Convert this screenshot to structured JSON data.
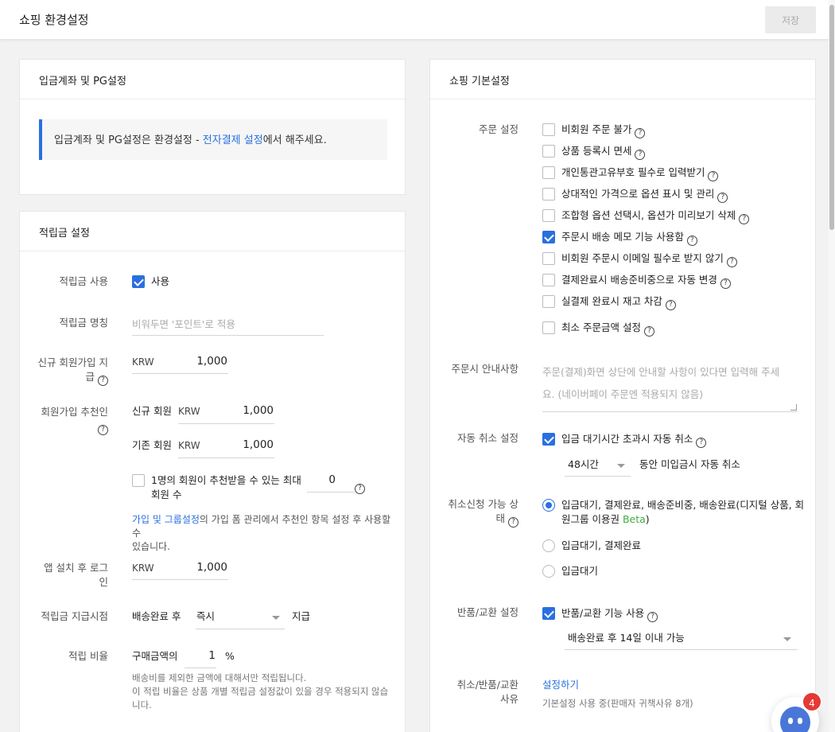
{
  "header": {
    "title": "쇼핑 환경설정",
    "save_label": "저장"
  },
  "payment": {
    "title": "입금계좌 및 PG설정",
    "notice_pre": "입금계좌 및 PG설정은 환경설정 - ",
    "notice_link": "전자결제 설정",
    "notice_post": "에서 해주세요."
  },
  "points": {
    "title": "적립금 설정",
    "use_label": "적립금 사용",
    "use_checkbox_label": "사용",
    "use_checked": true,
    "name_label": "적립금 명칭",
    "name_placeholder": "비워두면 '포인트'로 적용",
    "signup_label_1": "신규 회원가입 지",
    "signup_label_2": "급",
    "signup_currency": "KRW",
    "signup_value": "1,000",
    "referral_label": "회원가입 추천인",
    "new_member_label": "신규 회원",
    "new_member_currency": "KRW",
    "new_member_value": "1,000",
    "existing_member_label": "기존 회원",
    "existing_member_currency": "KRW",
    "existing_member_value": "1,000",
    "max_ref_label_1": "1명의 회원이 추천받을 수 있는 최대",
    "max_ref_label_2": "회원 수",
    "max_ref_value": "0",
    "max_ref_checked": false,
    "ref_note_link": "가입 및 그룹설정",
    "ref_note_1": "의 가입 폼 관리에서 추천인 항목 설정 후 사용할 수",
    "ref_note_2": "있습니다.",
    "app_label_1": "앱 설치 후 로그",
    "app_label_2": "인",
    "app_currency": "KRW",
    "app_value": "1,000",
    "timing_label": "적립금 지급시점",
    "timing_pre": "배송완료 후",
    "timing_value": "즉시",
    "timing_post": "지급",
    "rate_label": "적립 비율",
    "rate_pre": "구매금액의",
    "rate_value": "1",
    "rate_unit": "%",
    "rate_note_1": "배송비를 제외한 금액에 대해서만 적립됩니다.",
    "rate_note_2": "이 적립 비율은 상품 개별 적립금 설정값이 있을 경우 적용되지 않습",
    "rate_note_3": "니다."
  },
  "shopping": {
    "title": "쇼핑 기본설정",
    "order_label": "주문 설정",
    "order_options": [
      {
        "label": "비회원 주문 불가",
        "checked": false
      },
      {
        "label": "상품 등록시 면세",
        "checked": false
      },
      {
        "label": "개인통관고유부호 필수로 입력받기",
        "checked": false
      },
      {
        "label": "상대적인 가격으로 옵션 표시 및 관리",
        "checked": false
      },
      {
        "label": "조합형 옵션 선택시, 옵션가 미리보기 삭제",
        "checked": false
      },
      {
        "label": "주문시 배송 메모 기능 사용함",
        "checked": true
      },
      {
        "label": "비회원 주문시 이메일 필수로 받지 않기",
        "checked": false
      },
      {
        "label": "결제완료시 배송준비중으로 자동 변경",
        "checked": false
      },
      {
        "label": "실결제 완료시 재고 차감",
        "checked": false
      },
      {
        "label": "최소 주문금액 설정",
        "checked": false
      }
    ],
    "notice_label": "주문시 안내사항",
    "notice_placeholder_1": "주문(결제)화면 상단에 안내할 사항이 있다면 입력해 주세",
    "notice_placeholder_2": "요. (네이버페이 주문엔 적용되지 않음)",
    "auto_cancel_label": "자동 취소 설정",
    "auto_cancel_checkbox": "입금 대기시간 초과시 자동 취소",
    "auto_cancel_checked": true,
    "auto_cancel_time": "48시간",
    "auto_cancel_post": "동안 미입금시 자동 취소",
    "cancel_state_label_1": "취소신청 가능 상",
    "cancel_state_label_2": "태",
    "cancel_state_options": [
      {
        "line1": "입금대기, 결제완료, 배송준비중, 배송완료(디지털 상품, 회",
        "line2_pre": "원그룹 이용권 ",
        "beta": "Beta",
        "line2_post": ")",
        "selected": true
      },
      {
        "line1": "입금대기, 결제완료",
        "selected": false
      },
      {
        "line1": "입금대기",
        "selected": false
      }
    ],
    "return_label": "반품/교환 설정",
    "return_checkbox": "반품/교환 기능 사용",
    "return_checked": true,
    "return_period": "배송완료 후 14일 이내 가능",
    "reason_label_1": "취소/반품/교환",
    "reason_label_2": "사유",
    "reason_link": "설정하기",
    "reason_note": "기본설정 사용 중(판매자 귀책사유 8개)"
  },
  "chat": {
    "badge_count": "4"
  }
}
